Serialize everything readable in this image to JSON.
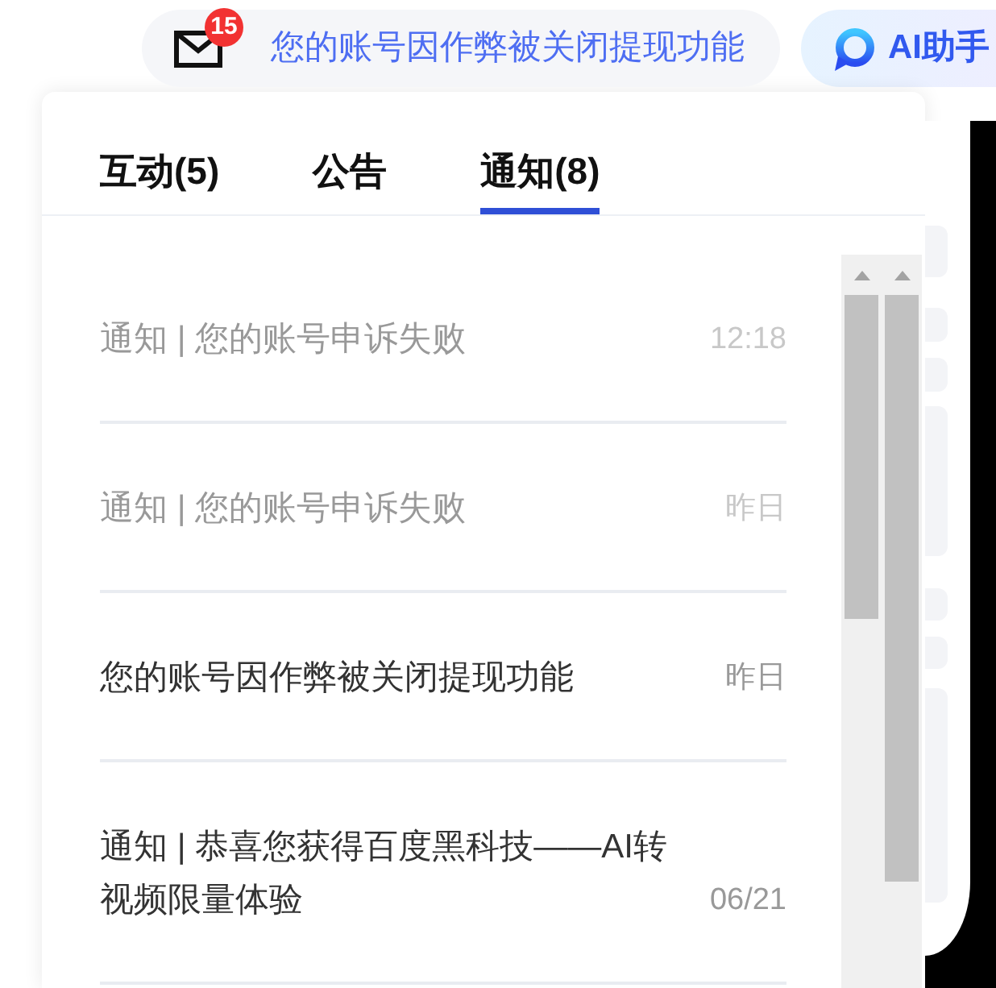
{
  "header": {
    "message": {
      "badge": "15",
      "text": "您的账号因作弊被关闭提现功能"
    },
    "assistant": {
      "label": "AI助手"
    }
  },
  "panel": {
    "tabs": [
      {
        "label": "互动(5)",
        "selected": false
      },
      {
        "label": "公告",
        "selected": false
      },
      {
        "label": "通知(8)",
        "selected": true
      }
    ],
    "notifications": [
      {
        "text": "通知 | 您的账号申诉失败",
        "time": "12:18",
        "read": true
      },
      {
        "text": "通知 | 您的账号申诉失败",
        "time": "昨日",
        "read": true
      },
      {
        "text": "您的账号因作弊被关闭提现功能",
        "time": "昨日",
        "read": false
      },
      {
        "text": "通知 | 恭喜您获得百度黑科技——AI转视频限量体验",
        "time": "06/21",
        "read": false
      }
    ]
  }
}
